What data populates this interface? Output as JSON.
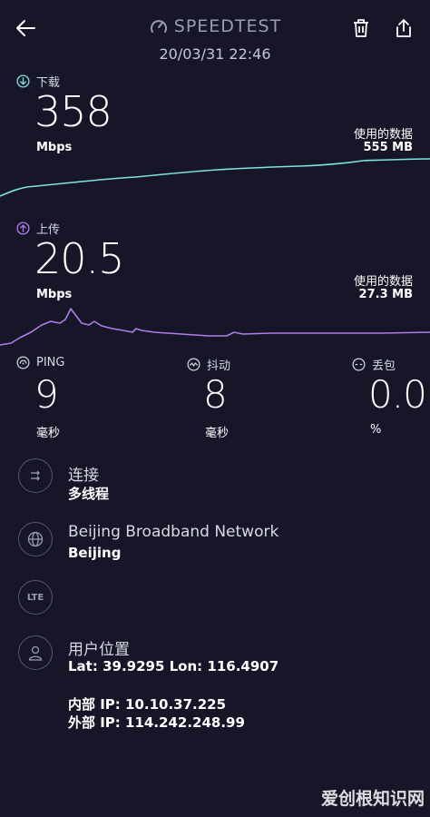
{
  "header": {
    "title": "SPEEDTEST",
    "datetime": "20/03/31 22:46"
  },
  "download": {
    "label": "下载",
    "value": "358",
    "unit": "Mbps",
    "data_used_label": "使用的数据",
    "data_used": "555 MB",
    "color": "#7fe3e0"
  },
  "upload": {
    "label": "上传",
    "value": "20.5",
    "unit": "Mbps",
    "data_used_label": "使用的数据",
    "data_used": "27.3 MB",
    "color": "#b07ee8"
  },
  "metrics": {
    "ping": {
      "label": "PING",
      "value": "9",
      "unit": "毫秒"
    },
    "jitter": {
      "label": "抖动",
      "value": "8",
      "unit": "毫秒"
    },
    "loss": {
      "label": "丢包",
      "value": "0.0",
      "unit": "%"
    }
  },
  "connection": {
    "label": "连接",
    "value": "多线程"
  },
  "provider": {
    "name": "Beijing Broadband Network",
    "location": "Beijing"
  },
  "network_type": "LTE",
  "user_location": {
    "label": "用户位置",
    "coords": "Lat: 39.9295 Lon: 116.4907",
    "internal_ip": "内部 IP: 10.10.37.225",
    "external_ip": "外部 IP: 114.242.248.99"
  },
  "watermark": "爱创根知识网"
}
